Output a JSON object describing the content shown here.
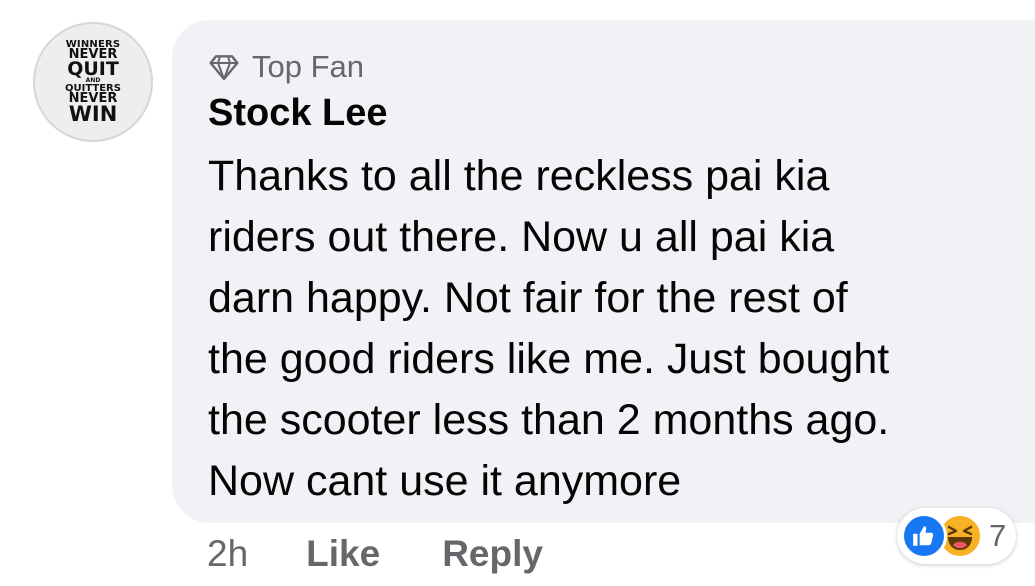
{
  "avatar": {
    "lines": [
      "WINNERS",
      "NEVER",
      "QUIT",
      "AND",
      "QUITTERS",
      "NEVER",
      "WIN"
    ]
  },
  "comment": {
    "badge_label": "Top Fan",
    "badge_icon": "diamond-icon",
    "author": "Stock Lee",
    "text": "Thanks to all the reckless pai kia\nriders out there. Now u all pai kia\ndarn happy. Not fair for the rest of\nthe good riders like me. Just bought\nthe scooter less than 2 months ago.\nNow cant use it anymore"
  },
  "actions": {
    "time": "2h",
    "like_label": "Like",
    "reply_label": "Reply"
  },
  "reactions": {
    "icons": [
      "like-icon",
      "haha-icon"
    ],
    "count": "7"
  },
  "colors": {
    "bubble": "#f0f2f5",
    "secondary_text": "#65676b",
    "primary_text": "#050505",
    "like_blue": "#1877f2",
    "haha_yellow": "#f7b125"
  }
}
